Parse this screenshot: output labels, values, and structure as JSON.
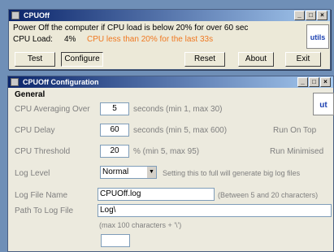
{
  "main_window": {
    "title": "CPUOff",
    "description": "Power Off the computer if CPU load is below 20% for over 60 sec",
    "cpu_load_label": "CPU Load:",
    "cpu_load_value": "4%",
    "cpu_status": "CPU less than 20% for the last 33s",
    "buttons": {
      "test": "Test",
      "configure": "Configure",
      "reset": "Reset",
      "about": "About",
      "exit": "Exit"
    },
    "logo_text": "utils"
  },
  "config_window": {
    "title": "CPUOff Configuration",
    "section_title": "General",
    "logo_text": "ut",
    "averaging_label": "CPU Averaging Over",
    "averaging_value": "5",
    "averaging_hint": "seconds (min 1, max 30)",
    "delay_label": "CPU Delay",
    "delay_value": "60",
    "delay_hint": "seconds (min 5, max 600)",
    "threshold_label": "CPU Threshold",
    "threshold_value": "20",
    "threshold_hint": "% (min 5, max 95)",
    "run_on_top": "Run On Top",
    "run_minimised": "Run Minimised",
    "log_level_label": "Log Level",
    "log_level_value": "Normal",
    "log_level_hint": "Setting this to full will generate big log files",
    "log_file_label": "Log File Name",
    "log_file_value": "CPUOff.log",
    "log_file_hint": "(Between 5 and 20 characters)",
    "log_path_label": "Path To Log File",
    "log_path_value": "Log\\",
    "log_path_hint": "(max 100 characters + '\\')"
  },
  "colors": {
    "status_orange": "#f07820",
    "desktop": "#6f8fb7"
  }
}
